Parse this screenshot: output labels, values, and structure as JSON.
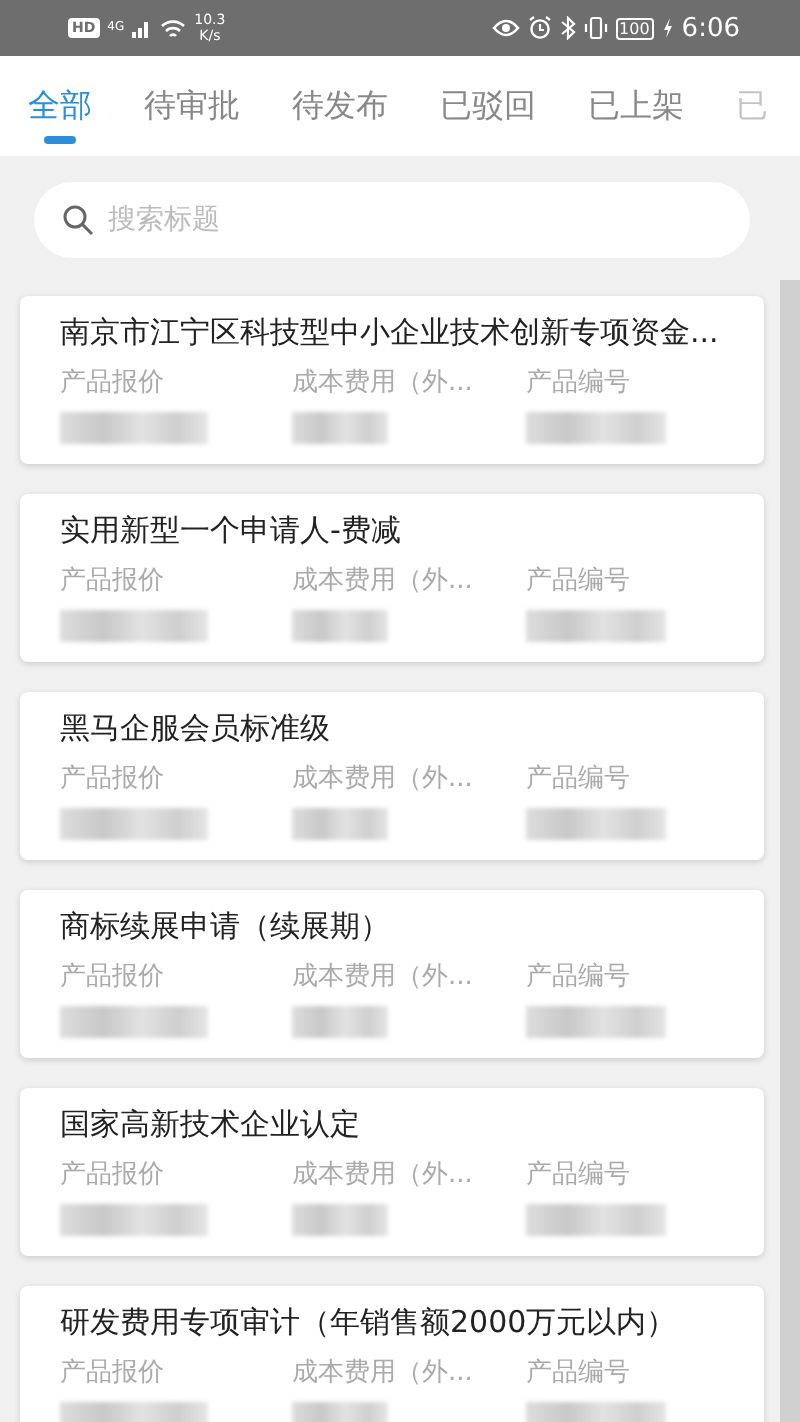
{
  "status_bar": {
    "hd": "HD",
    "network": "4G",
    "speed": "10.3",
    "speed_unit": "K/s",
    "battery": "100",
    "time": "6:06"
  },
  "tabs": [
    {
      "label": "全部",
      "selected": true
    },
    {
      "label": "待审批",
      "selected": false
    },
    {
      "label": "待发布",
      "selected": false
    },
    {
      "label": "已驳回",
      "selected": false
    },
    {
      "label": "已上架",
      "selected": false
    },
    {
      "label": "已",
      "selected": false,
      "faded": true
    }
  ],
  "search": {
    "placeholder": "搜索标题"
  },
  "cards": [
    {
      "title": "南京市江宁区科技型中小企业技术创新专项资金...",
      "fields": [
        "产品报价",
        "成本费用（外...",
        "产品编号"
      ]
    },
    {
      "title": "实用新型一个申请人-费减",
      "fields": [
        "产品报价",
        "成本费用（外...",
        "产品编号"
      ]
    },
    {
      "title": "黑马企服会员标准级",
      "fields": [
        "产品报价",
        "成本费用（外...",
        "产品编号"
      ]
    },
    {
      "title": "商标续展申请（续展期）",
      "fields": [
        "产品报价",
        "成本费用（外...",
        "产品编号"
      ]
    },
    {
      "title": "国家高新技术企业认定",
      "fields": [
        "产品报价",
        "成本费用（外...",
        "产品编号"
      ]
    },
    {
      "title": "研发费用专项审计（年销售额2000万元以内）",
      "fields": [
        "产品报价",
        "成本费用（外...",
        "产品编号"
      ]
    }
  ]
}
